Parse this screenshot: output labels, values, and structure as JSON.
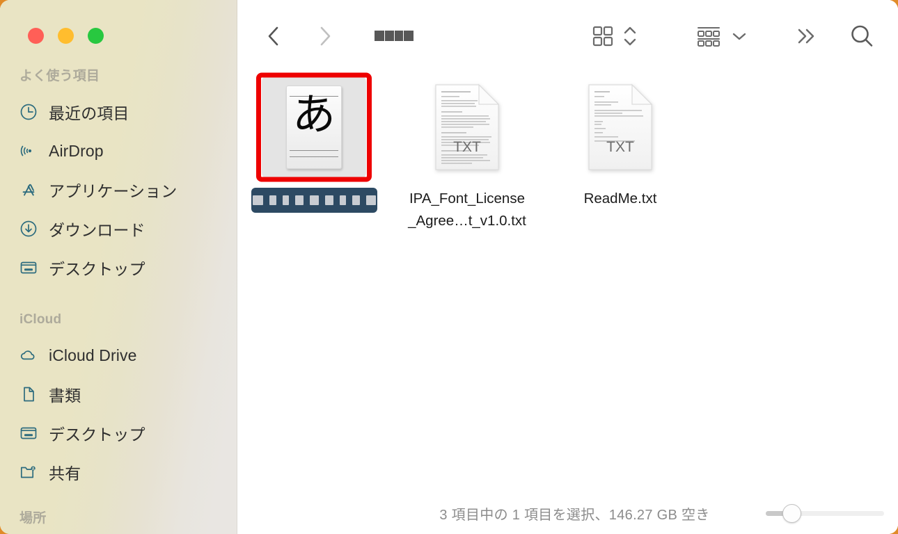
{
  "window": {
    "app": "Finder",
    "traffic_lights": [
      {
        "name": "close",
        "color": "#ff5f57"
      },
      {
        "name": "minimize",
        "color": "#ffbd2e"
      },
      {
        "name": "maximize",
        "color": "#28c840"
      }
    ],
    "desktop_accent": "#e08b28"
  },
  "sidebar": {
    "background_left": "#e9e4c4",
    "background_right": "#e9e6e2",
    "icon_color": "#2c6b7e",
    "sections": [
      {
        "header": "よく使う項目",
        "items": [
          {
            "icon": "clock-icon",
            "label": "最近の項目"
          },
          {
            "icon": "airdrop-icon",
            "label": "AirDrop"
          },
          {
            "icon": "applications-icon",
            "label": "アプリケーション"
          },
          {
            "icon": "download-icon",
            "label": "ダウンロード"
          },
          {
            "icon": "desktop-icon",
            "label": "デスクトップ"
          }
        ]
      },
      {
        "header": "iCloud",
        "items": [
          {
            "icon": "cloud-icon",
            "label": "iCloud Drive"
          },
          {
            "icon": "document-icon",
            "label": "書類"
          },
          {
            "icon": "desktop-icon",
            "label": "デスクトップ"
          },
          {
            "icon": "shared-folder-icon",
            "label": "共有"
          }
        ]
      },
      {
        "header": "場所",
        "items": []
      }
    ]
  },
  "toolbar": {
    "back_label": "戻る",
    "forward_label": "進む",
    "path_title_redacted": true,
    "path_title_redact_widths": [
      14,
      13,
      12,
      14
    ],
    "buttons": [
      {
        "name": "view-grid-icon",
        "label": "アイコン表示"
      },
      {
        "name": "sort-chevrons-icon",
        "label": "並び替え"
      },
      {
        "name": "group-items-icon",
        "label": "グループ分け"
      },
      {
        "name": "chevron-down-icon",
        "label": "表示オプション"
      },
      {
        "name": "more-chevrons-icon",
        "label": "その他"
      },
      {
        "name": "search-icon",
        "label": "検索"
      }
    ]
  },
  "files": [
    {
      "id": "font-file",
      "icon": "font-file-icon",
      "glyph": "あ",
      "name_redacted": true,
      "name_redact_widths": [
        15,
        10,
        9,
        12,
        13,
        12,
        9,
        11,
        14
      ],
      "selected": true,
      "annotated": true,
      "annotation_color": "#ee0000"
    },
    {
      "id": "ipa-license",
      "icon": "txt-file-icon",
      "badge": "TXT",
      "name": "IPA_Font_License_Agree…t_v1.0.txt",
      "name_line1": "IPA_Font_License",
      "name_line2": "_Agree…t_v1.0.txt",
      "selected": false,
      "annotated": false
    },
    {
      "id": "readme",
      "icon": "txt-file-icon",
      "badge": "TXT",
      "name": "ReadMe.txt",
      "name_line1": "ReadMe.txt",
      "name_line2": "",
      "selected": false,
      "annotated": false
    }
  ],
  "status_bar": {
    "text": "3 項目中の 1 項目を選択、146.27 GB 空き",
    "zoom_slider": {
      "name": "icon-size-slider",
      "value_percent": 22
    }
  }
}
